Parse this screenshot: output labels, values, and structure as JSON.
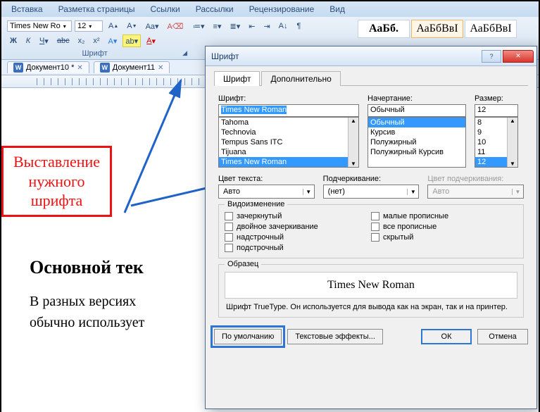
{
  "ribbon": {
    "tabs": [
      "Вставка",
      "Разметка страницы",
      "Ссылки",
      "Рассылки",
      "Рецензирование",
      "Вид"
    ],
    "font_name": "Times New Ro",
    "font_size": "12",
    "group_label": "Шрифт",
    "styles": [
      {
        "sample": "АаБб.",
        "name": ""
      },
      {
        "sample": "АаБбВвІ",
        "name": ""
      },
      {
        "sample": "АаБбВвІ",
        "name": ""
      }
    ]
  },
  "doc_tabs": [
    {
      "label": "Документ10 *"
    },
    {
      "label": "Документ11"
    }
  ],
  "callout": {
    "l1": "Выставление",
    "l2": "нужного",
    "l3": "шрифта"
  },
  "document": {
    "heading": "Основной тек",
    "para_l1": "В разных версиях",
    "para_l2": "обычно использует"
  },
  "dialog": {
    "title": "Шрифт",
    "tab_font": "Шрифт",
    "tab_adv": "Дополнительно",
    "lbl_font": "Шрифт:",
    "lbl_style": "Начертание:",
    "lbl_size": "Размер:",
    "font_value": "Times New Roman",
    "font_list": [
      "Tahoma",
      "Technovia",
      "Tempus Sans ITC",
      "Tijuana",
      "Times New Roman"
    ],
    "style_value": "Обычный",
    "style_list": [
      "Обычный",
      "Курсив",
      "Полужирный",
      "Полужирный Курсив"
    ],
    "size_value": "12",
    "size_list": [
      "8",
      "9",
      "10",
      "11",
      "12"
    ],
    "lbl_color": "Цвет текста:",
    "lbl_under": "Подчеркивание:",
    "lbl_ucolor": "Цвет подчеркивания:",
    "color_value": "Авто",
    "under_value": "(нет)",
    "ucolor_value": "Авто",
    "effects_leg": "Видоизменение",
    "chk_strike": "зачеркнутый",
    "chk_dstrike": "двойное зачеркивание",
    "chk_super": "надстрочный",
    "chk_sub": "подстрочный",
    "chk_smallcaps": "малые прописные",
    "chk_allcaps": "все прописные",
    "chk_hidden": "скрытый",
    "preview_leg": "Образец",
    "preview_text": "Times New Roman",
    "hint": "Шрифт TrueType. Он используется для вывода как на экран, так и на принтер.",
    "btn_default": "По умолчанию",
    "btn_effects": "Текстовые эффекты...",
    "btn_ok": "ОК",
    "btn_cancel": "Отмена"
  }
}
